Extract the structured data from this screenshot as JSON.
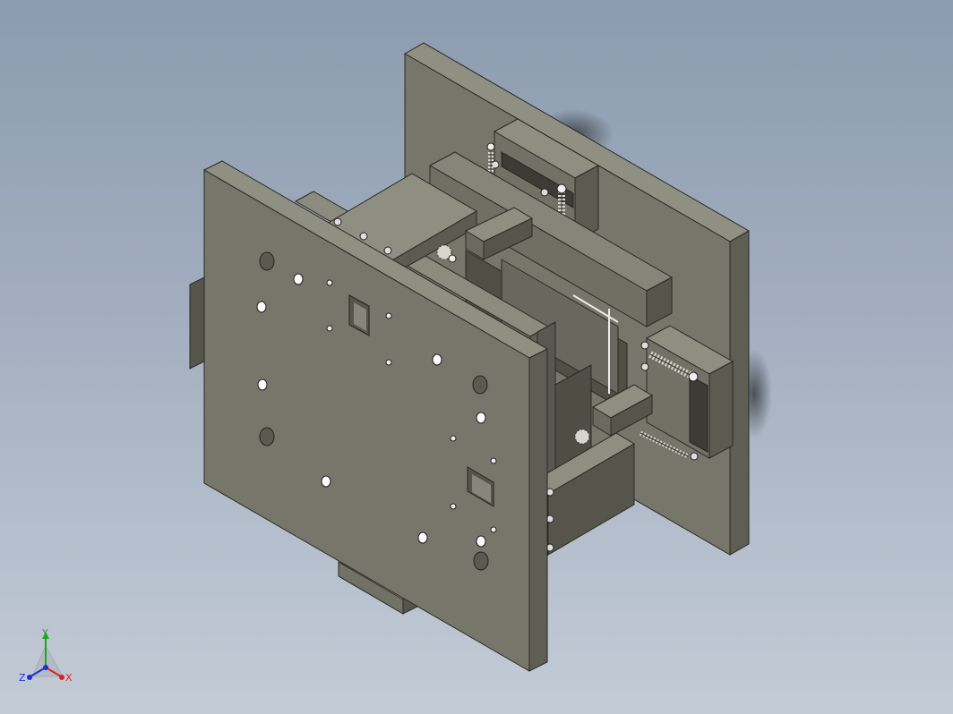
{
  "viewport": {
    "background_top": "#8c9bb0",
    "background_bottom": "#c3cbd6",
    "model_color": "#76766a"
  },
  "triad": {
    "x_label": "X",
    "y_label": "Y",
    "z_label": "Z",
    "x_color": "#e02020",
    "y_color": "#1fa81f",
    "z_color": "#2030d0"
  }
}
